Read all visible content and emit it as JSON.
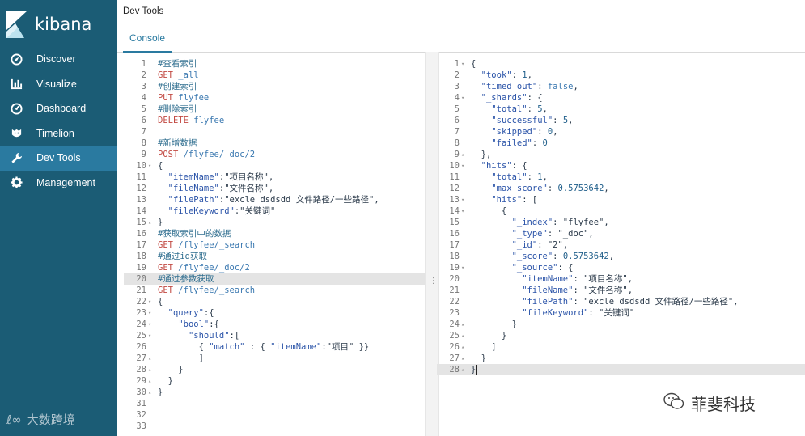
{
  "app": {
    "name": "kibana"
  },
  "sidebar": {
    "items": [
      {
        "label": "Discover",
        "icon": "compass-icon",
        "active": false
      },
      {
        "label": "Visualize",
        "icon": "bar-chart-icon",
        "active": false
      },
      {
        "label": "Dashboard",
        "icon": "dashboard-icon",
        "active": false
      },
      {
        "label": "Timelion",
        "icon": "timelion-icon",
        "active": false
      },
      {
        "label": "Dev Tools",
        "icon": "wrench-icon",
        "active": true
      },
      {
        "label": "Management",
        "icon": "gear-icon",
        "active": false
      }
    ],
    "watermark": "大数跨境"
  },
  "header": {
    "title": "Dev Tools",
    "tab": "Console"
  },
  "editor": {
    "highlighted_line": 20,
    "lines": [
      {
        "n": 1,
        "fold": "",
        "parts": [
          [
            "comment",
            "#查看索引"
          ]
        ]
      },
      {
        "n": 2,
        "fold": "",
        "parts": [
          [
            "method",
            "GET "
          ],
          [
            "path",
            "_all"
          ]
        ]
      },
      {
        "n": 3,
        "fold": "",
        "parts": [
          [
            "comment",
            "#创建索引"
          ]
        ]
      },
      {
        "n": 4,
        "fold": "",
        "parts": [
          [
            "method",
            "PUT "
          ],
          [
            "path",
            "flyfee"
          ]
        ]
      },
      {
        "n": 5,
        "fold": "",
        "parts": [
          [
            "comment",
            "#删除索引"
          ]
        ]
      },
      {
        "n": 6,
        "fold": "",
        "parts": [
          [
            "method",
            "DELETE "
          ],
          [
            "path",
            "flyfee"
          ]
        ]
      },
      {
        "n": 7,
        "fold": "",
        "parts": []
      },
      {
        "n": 8,
        "fold": "",
        "parts": [
          [
            "comment",
            "#新增数据"
          ]
        ]
      },
      {
        "n": 9,
        "fold": "",
        "parts": [
          [
            "method",
            "POST "
          ],
          [
            "path",
            "/flyfee/_doc/2"
          ]
        ]
      },
      {
        "n": 10,
        "fold": "▾",
        "parts": [
          [
            "str",
            "{"
          ]
        ]
      },
      {
        "n": 11,
        "fold": "",
        "parts": [
          [
            "str",
            "  "
          ],
          [
            "key",
            "\"itemName\""
          ],
          [
            "str",
            ":\"项目名称\","
          ]
        ]
      },
      {
        "n": 12,
        "fold": "",
        "parts": [
          [
            "str",
            "  "
          ],
          [
            "key",
            "\"fileName\""
          ],
          [
            "str",
            ":\"文件名称\","
          ]
        ]
      },
      {
        "n": 13,
        "fold": "",
        "parts": [
          [
            "str",
            "  "
          ],
          [
            "key",
            "\"filePath\""
          ],
          [
            "str",
            ":\"excle dsdsdd 文件路径/一些路径\","
          ]
        ]
      },
      {
        "n": 14,
        "fold": "",
        "parts": [
          [
            "str",
            "  "
          ],
          [
            "key",
            "\"fileKeyword\""
          ],
          [
            "str",
            ":\"关键词\""
          ]
        ]
      },
      {
        "n": 15,
        "fold": "▴",
        "parts": [
          [
            "str",
            "}"
          ]
        ]
      },
      {
        "n": 16,
        "fold": "",
        "parts": [
          [
            "comment",
            "#获取索引中的数据"
          ]
        ]
      },
      {
        "n": 17,
        "fold": "",
        "parts": [
          [
            "method",
            "GET "
          ],
          [
            "path",
            "/flyfee/_search"
          ]
        ]
      },
      {
        "n": 18,
        "fold": "",
        "parts": [
          [
            "comment",
            "#通过id获取"
          ]
        ]
      },
      {
        "n": 19,
        "fold": "",
        "parts": [
          [
            "method",
            "GET "
          ],
          [
            "path",
            "/flyfee/_doc/2"
          ]
        ]
      },
      {
        "n": 20,
        "fold": "",
        "parts": [
          [
            "comment",
            "#通过参数获取"
          ]
        ]
      },
      {
        "n": 21,
        "fold": "",
        "parts": [
          [
            "method",
            "GET "
          ],
          [
            "path",
            "/flyfee/_search"
          ]
        ]
      },
      {
        "n": 22,
        "fold": "▾",
        "parts": [
          [
            "str",
            "{"
          ]
        ]
      },
      {
        "n": 23,
        "fold": "▾",
        "parts": [
          [
            "str",
            "  "
          ],
          [
            "key",
            "\"query\""
          ],
          [
            "str",
            ":{"
          ]
        ]
      },
      {
        "n": 24,
        "fold": "▾",
        "parts": [
          [
            "str",
            "    "
          ],
          [
            "key",
            "\"bool\""
          ],
          [
            "str",
            ":{"
          ]
        ]
      },
      {
        "n": 25,
        "fold": "▾",
        "parts": [
          [
            "str",
            "      "
          ],
          [
            "key",
            "\"should\""
          ],
          [
            "str",
            ":["
          ]
        ]
      },
      {
        "n": 26,
        "fold": "",
        "parts": [
          [
            "str",
            "        { "
          ],
          [
            "key",
            "\"match\""
          ],
          [
            "str",
            " : { "
          ],
          [
            "key",
            "\"itemName\""
          ],
          [
            "str",
            ":\"项目\" }}"
          ]
        ]
      },
      {
        "n": 27,
        "fold": "▴",
        "parts": [
          [
            "str",
            "        ]"
          ]
        ]
      },
      {
        "n": 28,
        "fold": "▴",
        "parts": [
          [
            "str",
            "    }"
          ]
        ]
      },
      {
        "n": 29,
        "fold": "▴",
        "parts": [
          [
            "str",
            "  }"
          ]
        ]
      },
      {
        "n": 30,
        "fold": "▴",
        "parts": [
          [
            "str",
            "}"
          ]
        ]
      },
      {
        "n": 31,
        "fold": "",
        "parts": []
      },
      {
        "n": 32,
        "fold": "",
        "parts": []
      },
      {
        "n": 33,
        "fold": "",
        "parts": []
      }
    ]
  },
  "output": {
    "highlighted_line": 28,
    "lines": [
      {
        "n": 1,
        "fold": "▾",
        "parts": [
          [
            "str",
            "{"
          ]
        ]
      },
      {
        "n": 2,
        "fold": "",
        "parts": [
          [
            "str",
            "  "
          ],
          [
            "key",
            "\"took\""
          ],
          [
            "str",
            ": "
          ],
          [
            "num",
            "1"
          ],
          [
            "str",
            ","
          ]
        ]
      },
      {
        "n": 3,
        "fold": "",
        "parts": [
          [
            "str",
            "  "
          ],
          [
            "key",
            "\"timed_out\""
          ],
          [
            "str",
            ": "
          ],
          [
            "bool",
            "false"
          ],
          [
            "str",
            ","
          ]
        ]
      },
      {
        "n": 4,
        "fold": "▾",
        "parts": [
          [
            "str",
            "  "
          ],
          [
            "key",
            "\"_shards\""
          ],
          [
            "str",
            ": {"
          ]
        ]
      },
      {
        "n": 5,
        "fold": "",
        "parts": [
          [
            "str",
            "    "
          ],
          [
            "key",
            "\"total\""
          ],
          [
            "str",
            ": "
          ],
          [
            "num",
            "5"
          ],
          [
            "str",
            ","
          ]
        ]
      },
      {
        "n": 6,
        "fold": "",
        "parts": [
          [
            "str",
            "    "
          ],
          [
            "key",
            "\"successful\""
          ],
          [
            "str",
            ": "
          ],
          [
            "num",
            "5"
          ],
          [
            "str",
            ","
          ]
        ]
      },
      {
        "n": 7,
        "fold": "",
        "parts": [
          [
            "str",
            "    "
          ],
          [
            "key",
            "\"skipped\""
          ],
          [
            "str",
            ": "
          ],
          [
            "num",
            "0"
          ],
          [
            "str",
            ","
          ]
        ]
      },
      {
        "n": 8,
        "fold": "",
        "parts": [
          [
            "str",
            "    "
          ],
          [
            "key",
            "\"failed\""
          ],
          [
            "str",
            ": "
          ],
          [
            "num",
            "0"
          ]
        ]
      },
      {
        "n": 9,
        "fold": "▴",
        "parts": [
          [
            "str",
            "  },"
          ]
        ]
      },
      {
        "n": 10,
        "fold": "▾",
        "parts": [
          [
            "str",
            "  "
          ],
          [
            "key",
            "\"hits\""
          ],
          [
            "str",
            ": {"
          ]
        ]
      },
      {
        "n": 11,
        "fold": "",
        "parts": [
          [
            "str",
            "    "
          ],
          [
            "key",
            "\"total\""
          ],
          [
            "str",
            ": "
          ],
          [
            "num",
            "1"
          ],
          [
            "str",
            ","
          ]
        ]
      },
      {
        "n": 12,
        "fold": "",
        "parts": [
          [
            "str",
            "    "
          ],
          [
            "key",
            "\"max_score\""
          ],
          [
            "str",
            ": "
          ],
          [
            "num",
            "0.5753642"
          ],
          [
            "str",
            ","
          ]
        ]
      },
      {
        "n": 13,
        "fold": "▾",
        "parts": [
          [
            "str",
            "    "
          ],
          [
            "key",
            "\"hits\""
          ],
          [
            "str",
            ": ["
          ]
        ]
      },
      {
        "n": 14,
        "fold": "▾",
        "parts": [
          [
            "str",
            "      {"
          ]
        ]
      },
      {
        "n": 15,
        "fold": "",
        "parts": [
          [
            "str",
            "        "
          ],
          [
            "key",
            "\"_index\""
          ],
          [
            "str",
            ": \"flyfee\","
          ]
        ]
      },
      {
        "n": 16,
        "fold": "",
        "parts": [
          [
            "str",
            "        "
          ],
          [
            "key",
            "\"_type\""
          ],
          [
            "str",
            ": \"_doc\","
          ]
        ]
      },
      {
        "n": 17,
        "fold": "",
        "parts": [
          [
            "str",
            "        "
          ],
          [
            "key",
            "\"_id\""
          ],
          [
            "str",
            ": \"2\","
          ]
        ]
      },
      {
        "n": 18,
        "fold": "",
        "parts": [
          [
            "str",
            "        "
          ],
          [
            "key",
            "\"_score\""
          ],
          [
            "str",
            ": "
          ],
          [
            "num",
            "0.5753642"
          ],
          [
            "str",
            ","
          ]
        ]
      },
      {
        "n": 19,
        "fold": "▾",
        "parts": [
          [
            "str",
            "        "
          ],
          [
            "key",
            "\"_source\""
          ],
          [
            "str",
            ": {"
          ]
        ]
      },
      {
        "n": 20,
        "fold": "",
        "parts": [
          [
            "str",
            "          "
          ],
          [
            "key",
            "\"itemName\""
          ],
          [
            "str",
            ": \"项目名称\","
          ]
        ]
      },
      {
        "n": 21,
        "fold": "",
        "parts": [
          [
            "str",
            "          "
          ],
          [
            "key",
            "\"fileName\""
          ],
          [
            "str",
            ": \"文件名称\","
          ]
        ]
      },
      {
        "n": 22,
        "fold": "",
        "parts": [
          [
            "str",
            "          "
          ],
          [
            "key",
            "\"filePath\""
          ],
          [
            "str",
            ": \"excle dsdsdd 文件路径/一些路径\","
          ]
        ]
      },
      {
        "n": 23,
        "fold": "",
        "parts": [
          [
            "str",
            "          "
          ],
          [
            "key",
            "\"fileKeyword\""
          ],
          [
            "str",
            ": \"关键词\""
          ]
        ]
      },
      {
        "n": 24,
        "fold": "▴",
        "parts": [
          [
            "str",
            "        }"
          ]
        ]
      },
      {
        "n": 25,
        "fold": "▴",
        "parts": [
          [
            "str",
            "      }"
          ]
        ]
      },
      {
        "n": 26,
        "fold": "▴",
        "parts": [
          [
            "str",
            "    ]"
          ]
        ]
      },
      {
        "n": 27,
        "fold": "▴",
        "parts": [
          [
            "str",
            "  }"
          ]
        ]
      },
      {
        "n": 28,
        "fold": "▴",
        "parts": [
          [
            "str",
            "}"
          ]
        ]
      }
    ]
  },
  "watermark_right": "菲斐科技",
  "colors": {
    "sidebar": "#1b5c75",
    "active": "#2a7aa0",
    "method": "#c24a43",
    "comment": "#2f6e8f"
  }
}
